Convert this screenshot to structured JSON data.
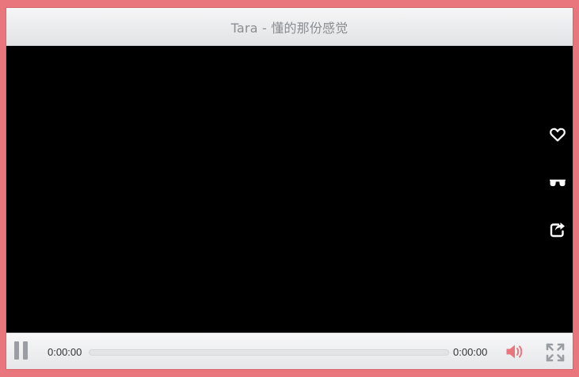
{
  "window": {
    "title": "Tara - 懂的那份感觉"
  },
  "side_actions": [
    {
      "icon": "heart-icon"
    },
    {
      "icon": "glasses-icon"
    },
    {
      "icon": "share-icon"
    }
  ],
  "controls": {
    "play_state_icon": "pause-icon",
    "current_time": "0:00:00",
    "duration": "0:00:00",
    "progress": 0,
    "volume_icon": "volume-icon",
    "fullscreen_icon": "fullscreen-icon"
  },
  "colors": {
    "accent": "#e9767c",
    "video_background": "#000000",
    "control_icon_gray": "#9a9da1"
  }
}
